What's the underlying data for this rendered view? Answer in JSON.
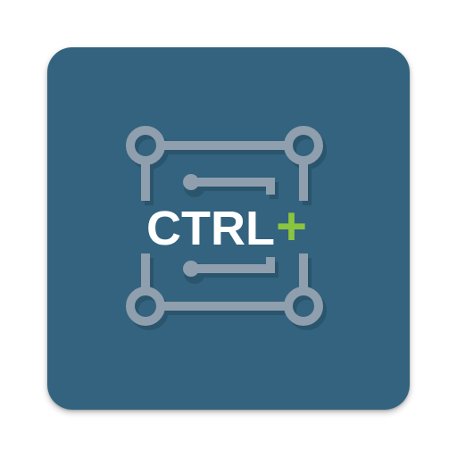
{
  "app_icon": {
    "text": "CTRL",
    "plus": "+",
    "icon_name": "circuit-board-icon",
    "colors": {
      "background": "#33637e",
      "circuit": "#8f9fad",
      "circuit_shadow": "#244a60",
      "text": "#ffffff",
      "plus": "#8bc53f"
    }
  }
}
